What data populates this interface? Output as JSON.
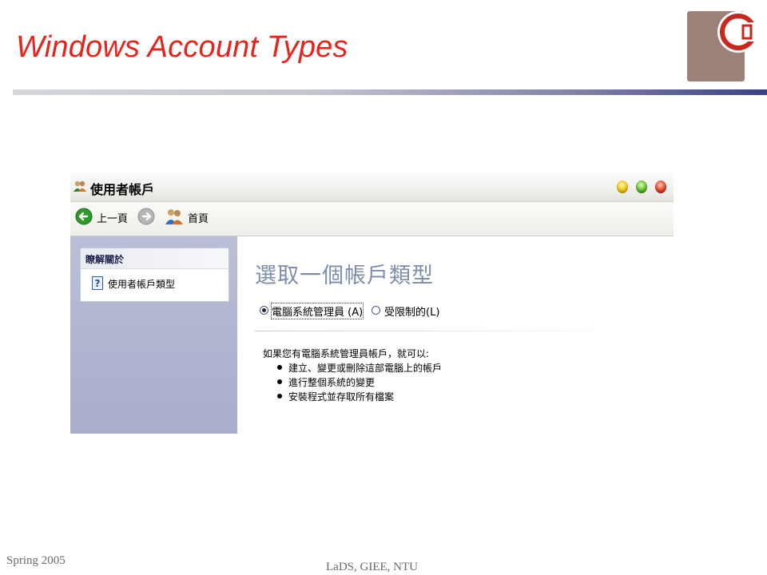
{
  "slide": {
    "title": "Windows Account Types",
    "footer_left": "Spring 2005",
    "footer_center": "LaDS, GIEE, NTU"
  },
  "window": {
    "title": "使用者帳戶",
    "toolbar": {
      "back_label": "上一頁",
      "home_label": "首頁"
    },
    "sidebar": {
      "panel_header": "瞭解關於",
      "link_label": "使用者帳戶類型"
    },
    "main": {
      "heading": "選取一個帳戶類型",
      "options": [
        {
          "label": "電腦系統管理員 (A)",
          "checked": true
        },
        {
          "label": "受限制的(L)",
          "checked": false
        }
      ],
      "description": "如果您有電腦系統管理員帳戶，就可以:",
      "bullets": [
        "建立、變更或刪除這部電腦上的帳戶",
        "進行整個系統的變更",
        "安裝程式並存取所有檔案"
      ]
    }
  },
  "colors": {
    "title_red": "#e8231b",
    "logo_brown": "#9b8178",
    "logo_red": "#c8281e",
    "sidebar_blue": "#a8aecb"
  },
  "icons": {
    "back": "back-arrow-icon",
    "forward": "forward-arrow-icon",
    "home": "users-home-icon",
    "help": "help-icon",
    "window_controls": [
      "minimize-icon",
      "maximize-icon",
      "close-icon"
    ]
  }
}
